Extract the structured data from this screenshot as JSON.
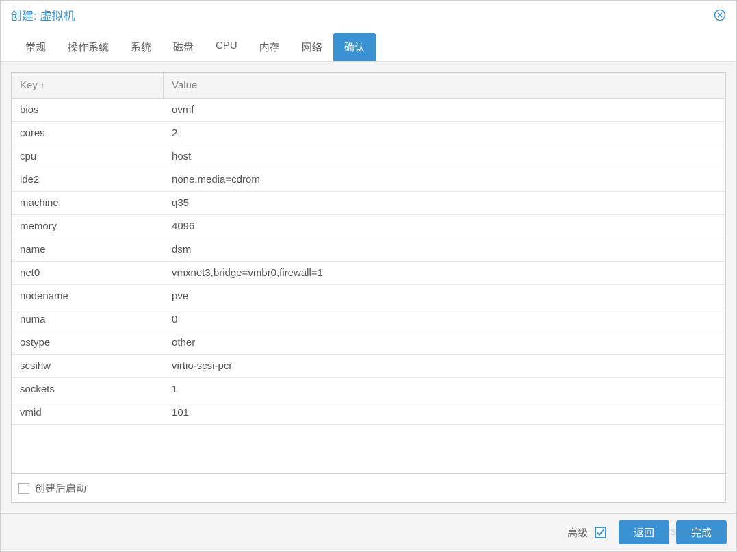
{
  "title": "创建: 虚拟机",
  "tabs": [
    {
      "label": "常规",
      "active": false
    },
    {
      "label": "操作系统",
      "active": false
    },
    {
      "label": "系统",
      "active": false
    },
    {
      "label": "磁盘",
      "active": false
    },
    {
      "label": "CPU",
      "active": false
    },
    {
      "label": "内存",
      "active": false
    },
    {
      "label": "网络",
      "active": false
    },
    {
      "label": "确认",
      "active": true
    }
  ],
  "table": {
    "header_key": "Key",
    "header_value": "Value",
    "sort_indicator": "↑",
    "rows": [
      {
        "key": "bios",
        "value": "ovmf"
      },
      {
        "key": "cores",
        "value": "2"
      },
      {
        "key": "cpu",
        "value": "host"
      },
      {
        "key": "ide2",
        "value": "none,media=cdrom"
      },
      {
        "key": "machine",
        "value": "q35"
      },
      {
        "key": "memory",
        "value": "4096"
      },
      {
        "key": "name",
        "value": "dsm"
      },
      {
        "key": "net0",
        "value": "vmxnet3,bridge=vmbr0,firewall=1"
      },
      {
        "key": "nodename",
        "value": "pve"
      },
      {
        "key": "numa",
        "value": "0"
      },
      {
        "key": "ostype",
        "value": "other"
      },
      {
        "key": "scsihw",
        "value": "virtio-scsi-pci"
      },
      {
        "key": "sockets",
        "value": "1"
      },
      {
        "key": "vmid",
        "value": "101"
      }
    ]
  },
  "start_after_create_label": "创建后启动",
  "advanced_label": "高级",
  "advanced_checked": true,
  "back_button": "返回",
  "finish_button": "完成",
  "watermark": "CSDN @sunky7"
}
